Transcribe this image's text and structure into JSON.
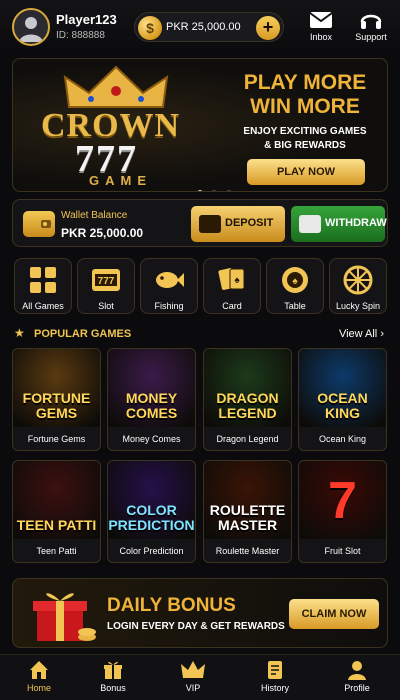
{
  "header": {
    "username": "Player123",
    "user_id": "ID: 888888",
    "balance": "PKR 25,000.00",
    "coin_symbol": "$",
    "plus_label": "+",
    "inbox_label": "Inbox",
    "support_label": "Support"
  },
  "banner": {
    "logo_line1": "CROWN",
    "logo_line2": "777",
    "logo_line3": "GAME",
    "headline1": "PLAY MORE",
    "headline2": "WIN MORE",
    "subline1": "ENJOY EXCITING GAMES",
    "subline2": "& BIG REWARDS",
    "play_label": "PLAY NOW",
    "active_slide": 1,
    "slide_count": 3
  },
  "wallet": {
    "label": "Wallet Balance",
    "amount": "PKR 25,000.00",
    "deposit_label": "DEPOSIT",
    "withdraw_label": "WITHDRAW"
  },
  "categories": [
    {
      "label": "All Games",
      "icon": "grid-icon"
    },
    {
      "label": "Slot",
      "icon": "slot-machine-icon"
    },
    {
      "label": "Fishing",
      "icon": "fish-icon"
    },
    {
      "label": "Card",
      "icon": "cards-icon"
    },
    {
      "label": "Table",
      "icon": "poker-chip-icon"
    },
    {
      "label": "Lucky Spin",
      "icon": "wheel-icon"
    }
  ],
  "popular": {
    "title": "POPULAR GAMES",
    "view_all": "View All",
    "games": [
      {
        "name": "Fortune Gems",
        "art_text": "FORTUNE GEMS",
        "bg": "#5a3a10",
        "fg": "#ffd75a"
      },
      {
        "name": "Money Comes",
        "art_text": "MONEY COMES",
        "bg": "#3b1b4a",
        "fg": "#ffd75a"
      },
      {
        "name": "Dragon Legend",
        "art_text": "DRAGON LEGEND",
        "bg": "#1c3a1a",
        "fg": "#ffd75a"
      },
      {
        "name": "Ocean King",
        "art_text": "OCEAN KING",
        "bg": "#0d3a6a",
        "fg": "#ffd75a"
      },
      {
        "name": "Teen Patti",
        "art_text": "TEEN PATTI",
        "bg": "#3c1010",
        "fg": "#ffd75a"
      },
      {
        "name": "Color Prediction",
        "art_text": "COLOR PREDICTION",
        "bg": "#24104a",
        "fg": "#7fe3ff"
      },
      {
        "name": "Roulette Master",
        "art_text": "ROULETTE MASTER",
        "bg": "#3a1406",
        "fg": "#ffffff"
      },
      {
        "name": "Fruit Slot",
        "art_text": "7",
        "bg": "#3a0a06",
        "fg": "#ff3a2a"
      }
    ]
  },
  "bonus": {
    "title": "DAILY BONUS",
    "subtitle": "LOGIN EVERY DAY & GET REWARDS",
    "claim_label": "CLAIM NOW"
  },
  "nav": [
    {
      "label": "Home",
      "icon": "home-icon",
      "active": true
    },
    {
      "label": "Bonus",
      "icon": "gift-icon",
      "active": false
    },
    {
      "label": "VIP",
      "icon": "crown-icon",
      "active": false
    },
    {
      "label": "History",
      "icon": "history-icon",
      "active": false
    },
    {
      "label": "Profile",
      "icon": "profile-icon",
      "active": false
    }
  ],
  "colors": {
    "gold": "#f1c453",
    "background": "#0b0b0d",
    "withdraw_green": "#2a8f2f"
  }
}
